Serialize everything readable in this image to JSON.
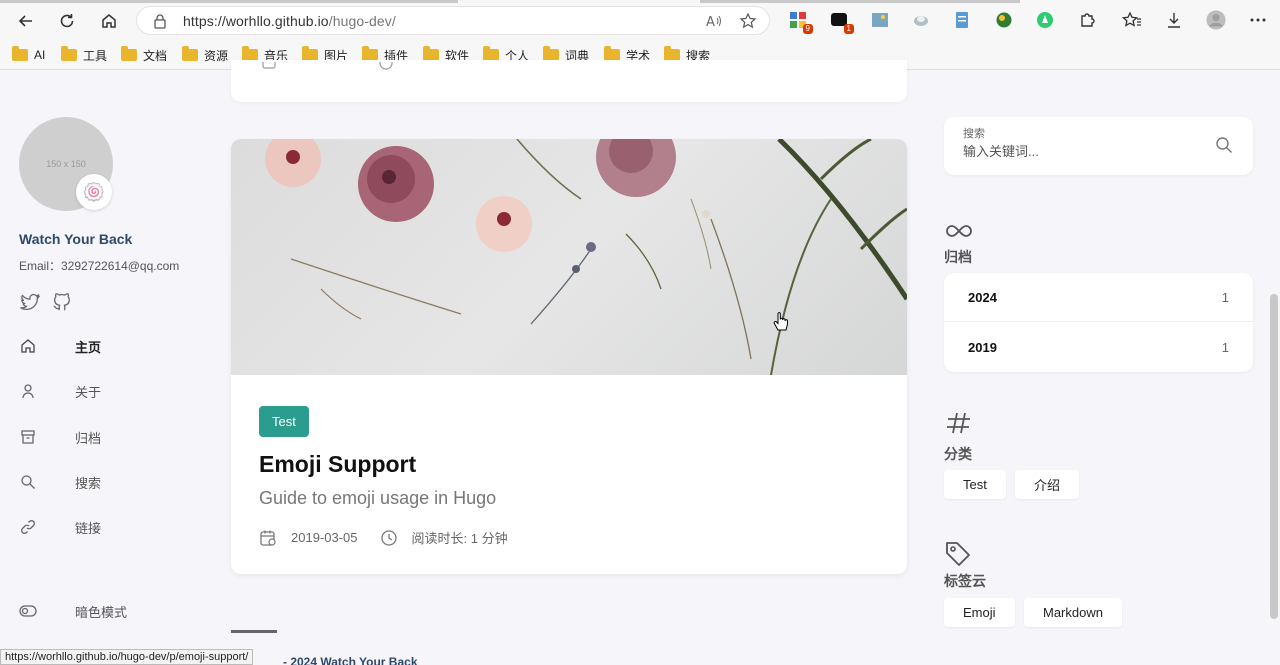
{
  "browser": {
    "url_host": "https://worhllo.github.io",
    "url_path": "/hugo-dev/",
    "extension_badges": [
      "9",
      "1"
    ],
    "bookmarks": [
      "AI",
      "工具",
      "文档",
      "资源",
      "音乐",
      "图片",
      "插件",
      "软件",
      "个人",
      "词典",
      "学术",
      "搜索"
    ]
  },
  "sidebar": {
    "avatar_placeholder": "150 x 150",
    "avatar_emoji": "🍥",
    "site_name": "Watch Your Back",
    "email": "Email：3292722614@qq.com",
    "menu": [
      {
        "label": "主页",
        "icon": "home-icon"
      },
      {
        "label": "关于",
        "icon": "user-icon"
      },
      {
        "label": "归档",
        "icon": "archive-icon"
      },
      {
        "label": "搜索",
        "icon": "search-icon"
      },
      {
        "label": "链接",
        "icon": "link-icon"
      }
    ],
    "dark_mode_label": "暗色模式"
  },
  "post": {
    "category": "Test",
    "title": "Emoji Support",
    "subtitle": "Guide to emoji usage in Hugo",
    "date": "2019-03-05",
    "reading_time": "阅读时长: 1 分钟"
  },
  "footer": {
    "text": "- 2024 Watch Your Back"
  },
  "status_bar": {
    "url": "https://worhllo.github.io/hugo-dev/p/emoji-support/"
  },
  "right": {
    "search_label": "搜索",
    "search_placeholder": "输入关键词...",
    "archives_title": "归档",
    "archives": [
      {
        "year": "2024",
        "count": "1"
      },
      {
        "year": "2019",
        "count": "1"
      }
    ],
    "categories_title": "分类",
    "categories": [
      "Test",
      "介绍"
    ],
    "tags_title": "标签云",
    "tags": [
      "Emoji",
      "Markdown"
    ]
  },
  "colors": {
    "accent": "#2a9d8f",
    "site_name": "#2e4a6b",
    "page_bg": "#f5f5fa"
  }
}
